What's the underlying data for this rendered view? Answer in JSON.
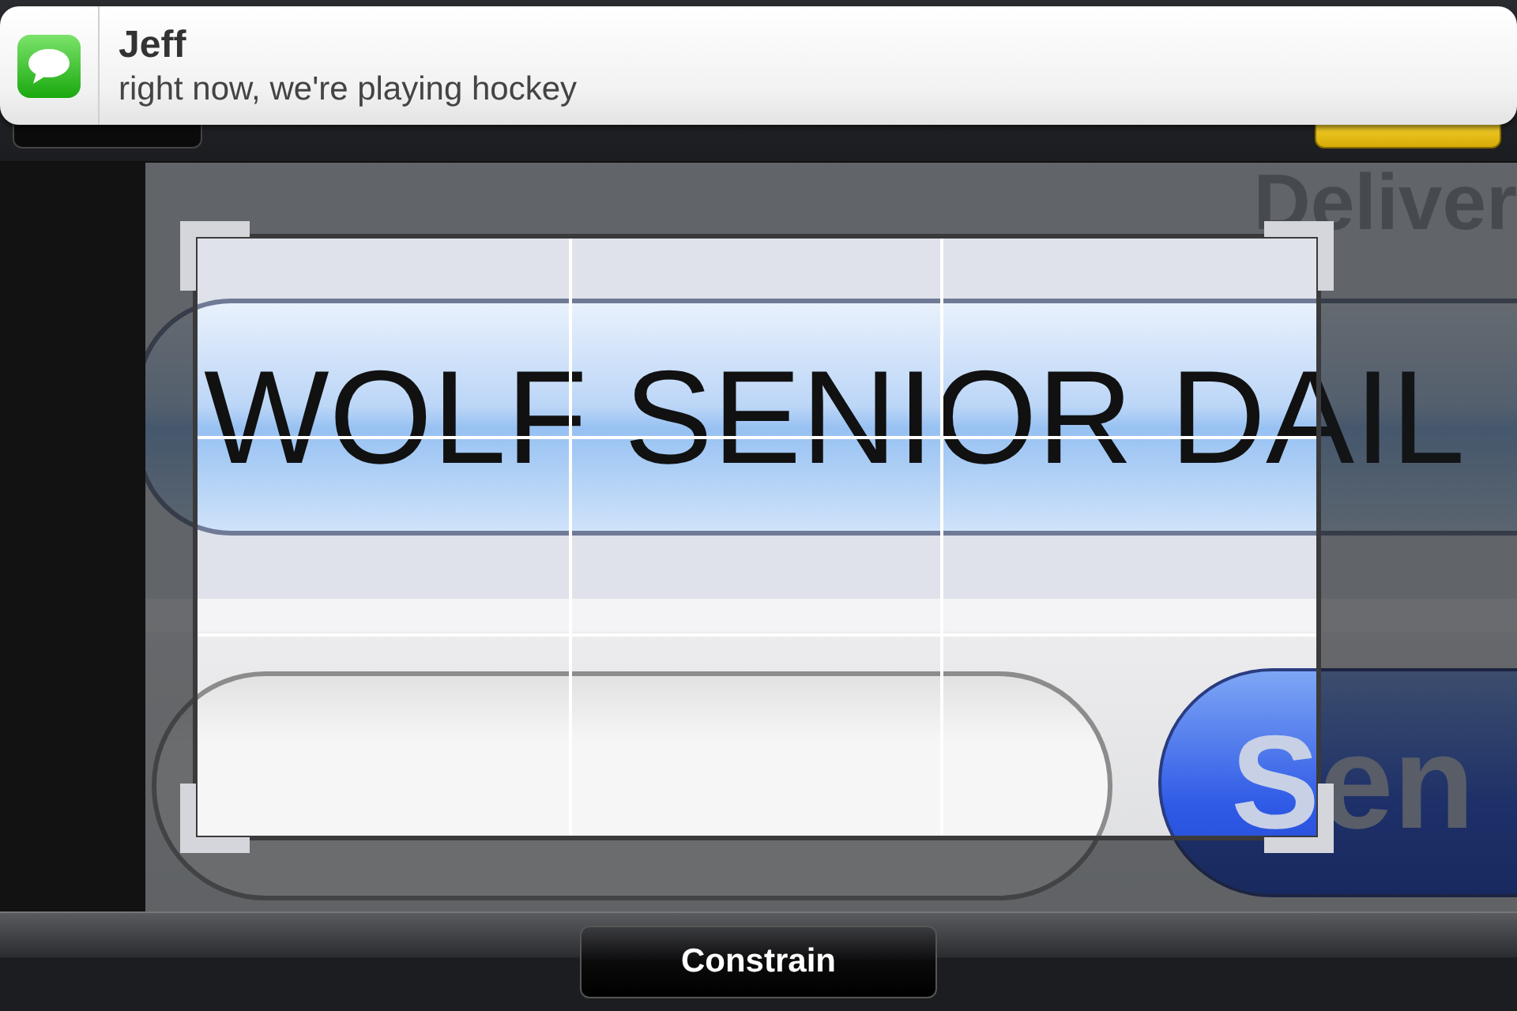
{
  "notification": {
    "sender": "Jeff",
    "message": "right now, we're playing hockey"
  },
  "photo": {
    "header_text": "Deliver",
    "field_text": "WOLF SENIOR DAIL",
    "send_label": "Sen"
  },
  "toolbar": {
    "button": "Constrain"
  }
}
